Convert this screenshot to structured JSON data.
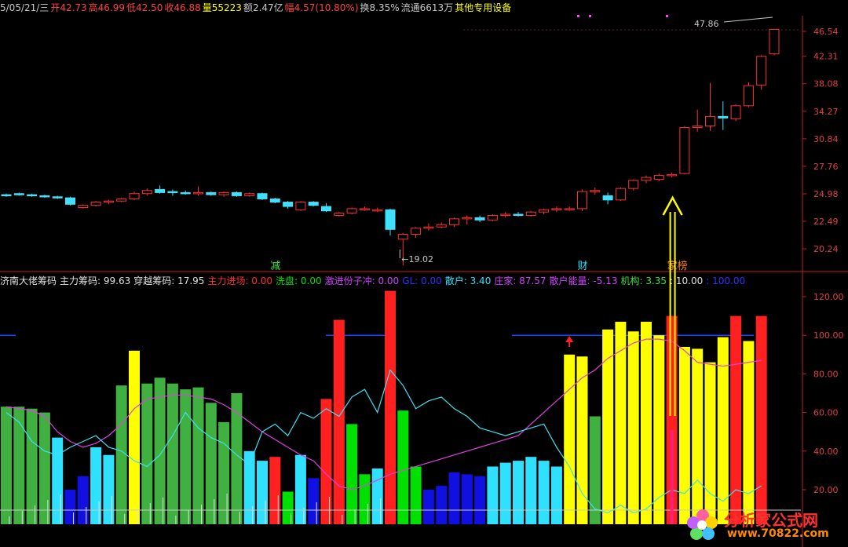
{
  "header": {
    "items": [
      {
        "text": "5/05/21/三",
        "color": "#c8c8c8"
      },
      {
        "text": "开42.73",
        "color": "#ff4040"
      },
      {
        "text": "高46.99",
        "color": "#ff4040"
      },
      {
        "text": "低42.50",
        "color": "#ff4040"
      },
      {
        "text": "收46.88",
        "color": "#ff4040"
      },
      {
        "text": "量55223",
        "color": "#ffff00"
      },
      {
        "text": "额2.47亿",
        "color": "#c8c8c8"
      },
      {
        "text": "幅4.57(10.80%)",
        "color": "#ff4040"
      },
      {
        "text": "换8.35%",
        "color": "#c8c8c8"
      },
      {
        "text": "流通6613万",
        "color": "#c8c8c8"
      },
      {
        "text": "其他专用设备",
        "color": "#ffff00"
      }
    ]
  },
  "indicator_header": {
    "items": [
      {
        "text": "济南大佬筹码",
        "color": "#e0e0e0"
      },
      {
        "text": "主力筹码: 99.63",
        "color": "#e0e0e0"
      },
      {
        "text": "穿越筹码: 17.95",
        "color": "#e0e0e0"
      },
      {
        "text": "主力进场: 0.00",
        "color": "#ff3030"
      },
      {
        "text": "洗盘: 0.00",
        "color": "#00e000"
      },
      {
        "text": "激进份子冲: 0.00",
        "color": "#d040ff"
      },
      {
        "text": "GL: 0.00",
        "color": "#3030ff"
      },
      {
        "text": "散户: 3.40",
        "color": "#30e0ff"
      },
      {
        "text": "庄家: 87.57",
        "color": "#d040ff"
      },
      {
        "text": "散户能量: -5.13",
        "color": "#d040ff"
      },
      {
        "text": "机构: 3.35",
        "color": "#40e040"
      },
      {
        "text": ": 10.00",
        "color": "#e0e0e0"
      },
      {
        "text": ": 100.00",
        "color": "#3030ff"
      }
    ]
  },
  "event_labels": [
    {
      "text": "减",
      "color": "#40e040",
      "x_index": 21
    },
    {
      "text": "财",
      "color": "#30e0ff",
      "x_index": 45
    },
    {
      "text": "家榜",
      "color": "#ff8000",
      "x_index": 52
    }
  ],
  "price_axis": [
    "46.54",
    "42.31",
    "38.08",
    "34.27",
    "30.84",
    "27.76",
    "24.98",
    "22.49",
    "20.24"
  ],
  "indicator_axis": [
    "120.00",
    "100.00",
    "80.00",
    "60.00",
    "40.00",
    "20.00"
  ],
  "annotations": {
    "high": "47.86",
    "low": "19.02"
  },
  "watermark": {
    "site": "分析家公式网",
    "url": "www.70822.com"
  },
  "colors": {
    "up": "#ff3030",
    "down": "#40e0ff",
    "axis": "#c02020",
    "grid": "#7a1a1a",
    "arrow": "#ffff00"
  },
  "chart_data": {
    "type": "bar",
    "candles": [
      [
        24.9,
        25.0,
        24.7,
        24.8
      ],
      [
        25.0,
        25.1,
        24.8,
        24.9
      ],
      [
        24.9,
        25.0,
        24.7,
        24.8
      ],
      [
        24.8,
        24.9,
        24.6,
        24.7
      ],
      [
        24.7,
        24.8,
        24.5,
        24.6
      ],
      [
        24.6,
        24.7,
        23.9,
        24.0
      ],
      [
        23.7,
        24.0,
        23.6,
        23.9
      ],
      [
        23.9,
        24.3,
        23.8,
        24.2
      ],
      [
        24.2,
        24.4,
        24.0,
        24.3
      ],
      [
        24.3,
        24.6,
        24.2,
        24.5
      ],
      [
        24.5,
        25.2,
        24.4,
        25.0
      ],
      [
        25.0,
        25.5,
        24.8,
        25.3
      ],
      [
        25.4,
        25.8,
        25.0,
        25.1
      ],
      [
        25.2,
        25.4,
        24.8,
        25.1
      ],
      [
        25.1,
        25.3,
        24.9,
        25.0
      ],
      [
        25.0,
        25.7,
        24.8,
        25.1
      ],
      [
        25.1,
        25.2,
        24.8,
        24.9
      ],
      [
        24.9,
        25.2,
        24.7,
        25.1
      ],
      [
        25.1,
        25.2,
        24.7,
        24.8
      ],
      [
        24.8,
        25.1,
        24.7,
        25.0
      ],
      [
        25.0,
        25.1,
        24.4,
        24.5
      ],
      [
        24.5,
        24.6,
        24.1,
        24.2
      ],
      [
        24.2,
        24.3,
        23.6,
        23.8
      ],
      [
        23.5,
        24.3,
        23.4,
        24.2
      ],
      [
        24.2,
        24.3,
        23.8,
        23.9
      ],
      [
        23.8,
        24.1,
        23.3,
        23.4
      ],
      [
        23.0,
        23.3,
        22.9,
        23.2
      ],
      [
        23.2,
        23.7,
        23.1,
        23.6
      ],
      [
        23.6,
        23.8,
        23.4,
        23.6
      ],
      [
        23.5,
        23.7,
        23.3,
        23.5
      ],
      [
        23.5,
        23.6,
        21.3,
        21.8
      ],
      [
        21.0,
        21.5,
        19.0,
        21.4
      ],
      [
        21.4,
        22.0,
        21.1,
        21.9
      ],
      [
        21.9,
        22.3,
        21.7,
        22.0
      ],
      [
        22.0,
        22.4,
        21.9,
        22.2
      ],
      [
        22.2,
        22.8,
        22.0,
        22.7
      ],
      [
        22.7,
        23.0,
        22.2,
        22.8
      ],
      [
        22.8,
        23.0,
        22.4,
        22.6
      ],
      [
        22.6,
        23.1,
        22.5,
        23.0
      ],
      [
        23.0,
        23.3,
        22.8,
        23.1
      ],
      [
        23.1,
        23.3,
        22.9,
        23.0
      ],
      [
        23.0,
        23.4,
        22.9,
        23.3
      ],
      [
        23.3,
        23.6,
        23.1,
        23.5
      ],
      [
        23.5,
        23.8,
        23.3,
        23.6
      ],
      [
        23.6,
        23.8,
        23.4,
        23.6
      ],
      [
        23.6,
        25.4,
        23.4,
        25.2
      ],
      [
        25.2,
        25.6,
        24.9,
        25.3
      ],
      [
        24.8,
        25.1,
        24.0,
        24.4
      ],
      [
        24.4,
        25.6,
        24.3,
        25.5
      ],
      [
        25.5,
        26.4,
        25.3,
        26.3
      ],
      [
        26.3,
        26.8,
        26.0,
        26.6
      ],
      [
        26.4,
        27.0,
        26.2,
        26.8
      ],
      [
        26.8,
        27.1,
        26.6,
        26.9
      ],
      [
        27.0,
        32.4,
        26.9,
        32.2
      ],
      [
        32.2,
        34.5,
        31.7,
        32.4
      ],
      [
        32.4,
        38.2,
        31.8,
        33.6
      ],
      [
        33.6,
        35.6,
        31.9,
        33.4
      ],
      [
        33.3,
        35.2,
        33.0,
        35.0
      ],
      [
        35.0,
        38.3,
        34.8,
        37.8
      ],
      [
        37.9,
        42.5,
        37.2,
        42.3
      ],
      [
        42.7,
        46.9,
        42.5,
        46.9
      ]
    ],
    "indicator_bars": [
      {
        "v": 63,
        "c": "#40b040"
      },
      {
        "v": 63,
        "c": "#40b040"
      },
      {
        "v": 62,
        "c": "#40b040"
      },
      {
        "v": 60,
        "c": "#40b040"
      },
      {
        "v": 47,
        "c": "#30e0ff"
      },
      {
        "v": 20,
        "c": "#1010e0"
      },
      {
        "v": 27,
        "c": "#1010e0"
      },
      {
        "v": 42,
        "c": "#30e0ff"
      },
      {
        "v": 38,
        "c": "#30e0ff"
      },
      {
        "v": 74,
        "c": "#40b040"
      },
      {
        "v": 92,
        "c": "#ffff00"
      },
      {
        "v": 75,
        "c": "#40b040"
      },
      {
        "v": 78,
        "c": "#40b040"
      },
      {
        "v": 75,
        "c": "#40b040"
      },
      {
        "v": 72,
        "c": "#40b040"
      },
      {
        "v": 73,
        "c": "#40b040"
      },
      {
        "v": 65,
        "c": "#40b040"
      },
      {
        "v": 55,
        "c": "#40b040"
      },
      {
        "v": 70,
        "c": "#40b040"
      },
      {
        "v": 40,
        "c": "#30e0ff"
      },
      {
        "v": 35,
        "c": "#30e0ff"
      },
      {
        "v": 37,
        "c": "#ff2020"
      },
      {
        "v": 19,
        "c": "#00e000"
      },
      {
        "v": 38,
        "c": "#30e0ff"
      },
      {
        "v": 26,
        "c": "#1010e0"
      },
      {
        "v": 67,
        "c": "#ff2020"
      },
      {
        "v": 108,
        "c": "#ff2020"
      },
      {
        "v": 54,
        "c": "#00e000"
      },
      {
        "v": 28,
        "c": "#00e000"
      },
      {
        "v": 31,
        "c": "#30e0ff"
      },
      {
        "v": 123,
        "c": "#ff2020"
      },
      {
        "v": 61,
        "c": "#00e000"
      },
      {
        "v": 32,
        "c": "#00e000"
      },
      {
        "v": 20,
        "c": "#1010e0"
      },
      {
        "v": 22,
        "c": "#1010e0"
      },
      {
        "v": 29,
        "c": "#1010e0"
      },
      {
        "v": 28,
        "c": "#1010e0"
      },
      {
        "v": 27,
        "c": "#1010e0"
      },
      {
        "v": 32,
        "c": "#30e0ff"
      },
      {
        "v": 34,
        "c": "#30e0ff"
      },
      {
        "v": 35,
        "c": "#30e0ff"
      },
      {
        "v": 37,
        "c": "#30e0ff"
      },
      {
        "v": 35,
        "c": "#30e0ff"
      },
      {
        "v": 32,
        "c": "#30e0ff"
      },
      {
        "v": 90,
        "c": "#ffff00"
      },
      {
        "v": 89,
        "c": "#ffff00"
      },
      {
        "v": 58,
        "c": "#40b040"
      },
      {
        "v": 103,
        "c": "#ffff00"
      },
      {
        "v": 107,
        "c": "#ffff00"
      },
      {
        "v": 102,
        "c": "#ffff00"
      },
      {
        "v": 107,
        "c": "#ffff00"
      },
      {
        "v": 100,
        "c": "#ffff00"
      },
      {
        "v": 110,
        "c": "#ff2020"
      },
      {
        "v": 94,
        "c": "#ffff00"
      },
      {
        "v": 93,
        "c": "#ffff00"
      },
      {
        "v": 86,
        "c": "#ffff00"
      },
      {
        "v": 99,
        "c": "#ffff00"
      },
      {
        "v": 110,
        "c": "#ff2020"
      },
      {
        "v": 97,
        "c": "#ffff00"
      },
      {
        "v": 110,
        "c": "#ff2020"
      }
    ],
    "line_magenta": [
      63,
      62,
      61,
      58,
      50,
      45,
      42,
      44,
      48,
      54,
      62,
      67,
      68,
      69,
      69,
      68,
      67,
      64,
      60,
      55,
      50,
      46,
      42,
      38,
      35,
      28,
      22,
      20,
      22,
      25,
      28,
      30,
      32,
      34,
      36,
      38,
      40,
      42,
      44,
      46,
      48,
      54,
      60,
      66,
      72,
      78,
      82,
      88,
      92,
      96,
      98,
      98,
      97,
      92,
      86,
      85,
      84,
      85,
      86,
      87
    ],
    "line_cyan": [
      60,
      55,
      45,
      40,
      38,
      42,
      45,
      48,
      42,
      40,
      35,
      32,
      38,
      48,
      60,
      52,
      47,
      44,
      38,
      33,
      50,
      54,
      48,
      60,
      57,
      62,
      58,
      68,
      72,
      60,
      82,
      74,
      62,
      66,
      68,
      62,
      58,
      52,
      50,
      48,
      50,
      52,
      54,
      42,
      32,
      18,
      10,
      8,
      12,
      8,
      10,
      16,
      20,
      18,
      25,
      18,
      14,
      20,
      18,
      22
    ],
    "ref_line_blue": 100,
    "indicator_ylim": [
      0,
      125
    ],
    "price_ylim": [
      19.0,
      48.0
    ]
  }
}
